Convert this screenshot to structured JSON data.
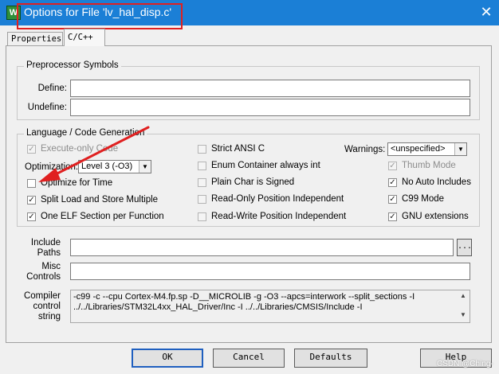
{
  "window": {
    "title": "Options for File 'lv_hal_disp.c'",
    "app_icon_glyph": "W",
    "close_glyph": "✕"
  },
  "tabs": [
    {
      "label": "Properties",
      "active": false
    },
    {
      "label": "C/C++",
      "active": true
    }
  ],
  "preprocessor": {
    "group_label": "Preprocessor Symbols",
    "define_label": "Define:",
    "define_value": "",
    "undefine_label": "Undefine:",
    "undefine_value": ""
  },
  "language": {
    "group_label": "Language / Code Generation",
    "execute_only_code": {
      "label": "Execute-only Code",
      "checked": true,
      "enabled": false
    },
    "optimization_label": "Optimization:",
    "optimization_value": "Level 3 (-O3)",
    "optimize_for_time": {
      "label": "Optimize for Time",
      "checked": false,
      "enabled": true
    },
    "split_load_store": {
      "label": "Split Load and Store Multiple",
      "checked": true,
      "enabled": true
    },
    "one_elf_section": {
      "label": "One ELF Section per Function",
      "checked": true,
      "enabled": true
    },
    "strict_ansi_c": {
      "label": "Strict ANSI C",
      "checked": false,
      "enabled": true
    },
    "enum_container": {
      "label": "Enum Container always int",
      "checked": false,
      "enabled": true
    },
    "plain_char_signed": {
      "label": "Plain Char is Signed",
      "checked": false,
      "enabled": true
    },
    "ro_position_independent": {
      "label": "Read-Only Position Independent",
      "checked": false,
      "enabled": true
    },
    "rw_position_independent": {
      "label": "Read-Write Position Independent",
      "checked": false,
      "enabled": true
    },
    "warnings_label": "Warnings:",
    "warnings_value": "<unspecified>",
    "thumb_mode": {
      "label": "Thumb Mode",
      "checked": true,
      "enabled": false
    },
    "no_auto_includes": {
      "label": "No Auto Includes",
      "checked": true,
      "enabled": true
    },
    "c99_mode": {
      "label": "C99 Mode",
      "checked": true,
      "enabled": true
    },
    "gnu_extensions": {
      "label": "GNU extensions",
      "checked": true,
      "enabled": true
    }
  },
  "include_paths": {
    "label_line1": "Include",
    "label_line2": "Paths",
    "value": "",
    "browse_label": "..."
  },
  "misc_controls": {
    "label_line1": "Misc",
    "label_line2": "Controls",
    "value": ""
  },
  "compiler_control": {
    "label_line1": "Compiler",
    "label_line2": "control",
    "label_line3": "string",
    "line1": "-c99 -c --cpu Cortex-M4.fp.sp -D__MICROLIB -g -O3 --apcs=interwork --split_sections -I",
    "line2": "../../Libraries/STM32L4xx_HAL_Driver/Inc -I ../../Libraries/CMSIS/Include -I"
  },
  "buttons": {
    "ok": "OK",
    "cancel": "Cancel",
    "defaults": "Defaults",
    "help": "Help"
  },
  "watermark": "CSDN @Ching-",
  "colors": {
    "titlebar": "#1b7fd6",
    "highlight": "#e02020",
    "arrow": "#e02020"
  },
  "icons": {
    "check": "✓",
    "dropdown": "▼",
    "scroll_up": "▲",
    "scroll_down": "▼"
  }
}
